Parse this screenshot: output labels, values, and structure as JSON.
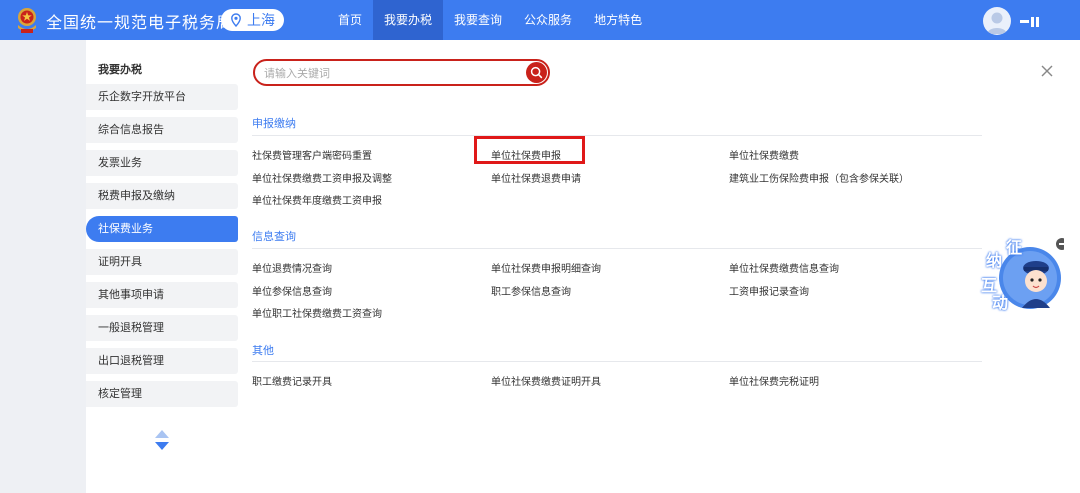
{
  "header": {
    "brand": "全国统一规范电子税务局",
    "region": "上海",
    "nav": [
      "首页",
      "我要办税",
      "我要查询",
      "公众服务",
      "地方特色"
    ],
    "active_nav_index": 1
  },
  "sidebar": {
    "title": "我要办税",
    "items": [
      "乐企数字开放平台",
      "综合信息报告",
      "发票业务",
      "税费申报及缴纳",
      "社保费业务",
      "证明开具",
      "其他事项申请",
      "一般退税管理",
      "出口退税管理",
      "核定管理"
    ],
    "active_index": 4
  },
  "search": {
    "placeholder": "请输入关键词"
  },
  "sections": [
    {
      "title": "申报缴纳",
      "links": [
        "社保费管理客户端密码重置",
        "单位社保费申报",
        "单位社保费缴费",
        "单位社保费缴费工资申报及调整",
        "单位社保费退费申请",
        "建筑业工伤保险费申报（包含参保关联）",
        "单位社保费年度缴费工资申报"
      ]
    },
    {
      "title": "信息查询",
      "links": [
        "单位退费情况查询",
        "单位社保费申报明细查询",
        "单位社保费缴费信息查询",
        "单位参保信息查询",
        "职工参保信息查询",
        "工资申报记录查询",
        "单位职工社保费缴费工资查询"
      ]
    },
    {
      "title": "其他",
      "links": [
        "职工缴费记录开具",
        "单位社保费缴费证明开具",
        "单位社保费完税证明"
      ]
    }
  ],
  "highlighted_link": "单位社保费申报",
  "assistant": {
    "chars": [
      "征",
      "纳",
      "互",
      "动"
    ]
  },
  "colors": {
    "primary": "#3d7cf0",
    "search_border": "#c9221b",
    "highlight_box": "#e01818"
  }
}
